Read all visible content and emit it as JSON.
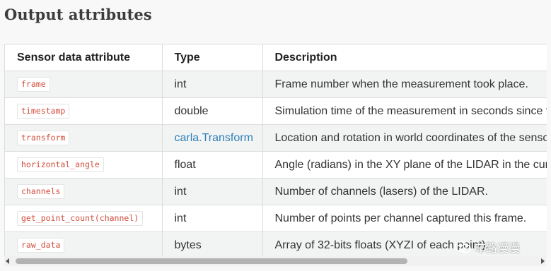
{
  "page": {
    "title": "Output attributes"
  },
  "table": {
    "headers": [
      "Sensor data attribute",
      "Type",
      "Description"
    ],
    "rows": [
      {
        "attribute": "frame",
        "type": "int",
        "type_is_link": false,
        "description": "Frame number when the measurement took place."
      },
      {
        "attribute": "timestamp",
        "type": "double",
        "type_is_link": false,
        "description": "Simulation time of the measurement in seconds since the beginning of the episode."
      },
      {
        "attribute": "transform",
        "type": "carla.Transform",
        "type_is_link": true,
        "description": "Location and rotation in world coordinates of the sensor at the time of the measurement."
      },
      {
        "attribute": "horizontal_angle",
        "type": "float",
        "type_is_link": false,
        "description": "Angle (radians) in the XY plane of the LIDAR in the current frame."
      },
      {
        "attribute": "channels",
        "type": "int",
        "type_is_link": false,
        "description": "Number of channels (lasers) of the LIDAR."
      },
      {
        "attribute": "get_point_count(channel)",
        "type": "int",
        "type_is_link": false,
        "description": "Number of points per channel captured this frame."
      },
      {
        "attribute": "raw_data",
        "type": "bytes",
        "type_is_link": false,
        "description": "Array of 32-bits floats (XYZI of each point)."
      }
    ]
  },
  "scrollbar": {
    "horizontal_position_fraction": 0.0,
    "visible_fraction": 0.74
  },
  "watermark": {
    "text": "车路漫漫",
    "icon": "wechat-icon"
  },
  "colors": {
    "code_text": "#d14d3c",
    "link": "#2f7fb8",
    "stripe": "#f2f4f4"
  }
}
